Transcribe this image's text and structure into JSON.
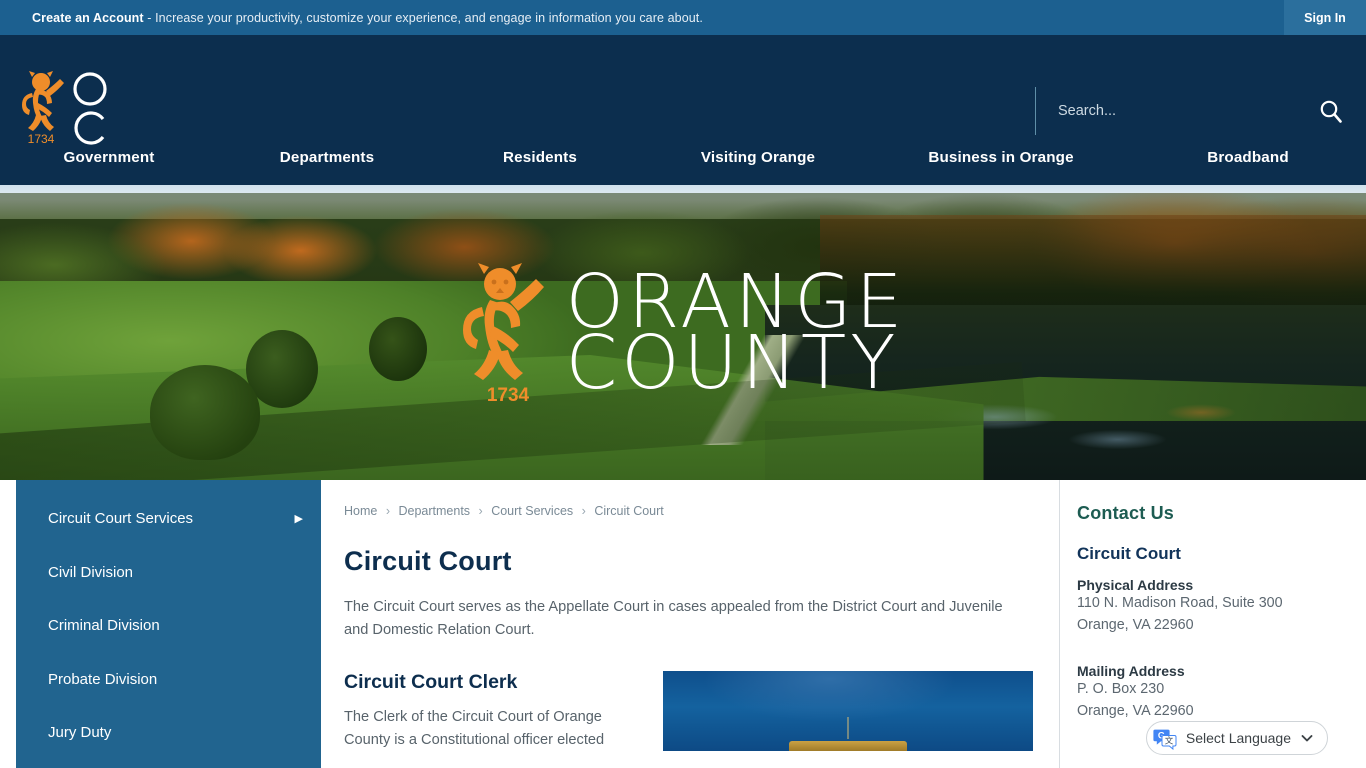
{
  "top_bar": {
    "cta_strong": "Create an Account",
    "cta_rest": " - Increase your productivity, customize your experience, and engage in information you care about.",
    "sign_in_label": "Sign In"
  },
  "header": {
    "logo_alt": "Orange County 1734 lion logo",
    "logo_year": "1734",
    "logo_monogram_o": "O",
    "logo_monogram_c": "C",
    "search": {
      "placeholder": "Search...",
      "value": "",
      "icon": "search-icon"
    },
    "nav": [
      {
        "label": "Government"
      },
      {
        "label": "Departments"
      },
      {
        "label": "Residents"
      },
      {
        "label": "Visiting Orange"
      },
      {
        "label": "Business in Orange"
      },
      {
        "label": "Broadband"
      }
    ]
  },
  "hero": {
    "wordmark_line1": "ORANGE",
    "wordmark_line2": "COUNTY",
    "lion_year": "1734"
  },
  "sidebar": {
    "items": [
      {
        "label": "Circuit Court Services",
        "has_submenu": true,
        "arrow": "▶"
      },
      {
        "label": "Civil Division",
        "has_submenu": false,
        "arrow": ""
      },
      {
        "label": "Criminal Division",
        "has_submenu": false,
        "arrow": ""
      },
      {
        "label": "Probate Division",
        "has_submenu": false,
        "arrow": ""
      },
      {
        "label": "Jury Duty",
        "has_submenu": false,
        "arrow": ""
      }
    ]
  },
  "main": {
    "breadcrumb": [
      {
        "label": "Home"
      },
      {
        "label": "Departments"
      },
      {
        "label": "Court Services"
      },
      {
        "label": "Circuit Court"
      }
    ],
    "breadcrumb_separator": "›",
    "page_title": "Circuit Court",
    "intro": "The Circuit Court serves as the Appellate Court in cases appealed from the District Court and Juvenile and Domestic Relation Court.",
    "clerk_heading": "Circuit Court Clerk",
    "clerk_body": "The Clerk of the Circuit Court of Orange County is a Constitutional officer elected",
    "clerk_image_alt": "Courthouse dome against blue sky"
  },
  "contact": {
    "heading": "Contact Us",
    "name": "Circuit Court",
    "physical_label": "Physical Address",
    "physical_line1": "110 N. Madison Road, Suite 300",
    "physical_line2": "Orange, VA 22960",
    "mailing_label": "Mailing Address",
    "mailing_line1": "P. O. Box 230",
    "mailing_line2": "Orange, VA 22960"
  },
  "translate": {
    "label": "Select Language",
    "chevron": "⌄",
    "icon": "google-translate-icon"
  },
  "colors": {
    "top_bar": "#1c6090",
    "header": "#0c2e4e",
    "sidebar": "#21648f",
    "accent_orange": "#ef8d2a",
    "title_navy": "#0d2e4e",
    "contact_green": "#1d5c52"
  }
}
